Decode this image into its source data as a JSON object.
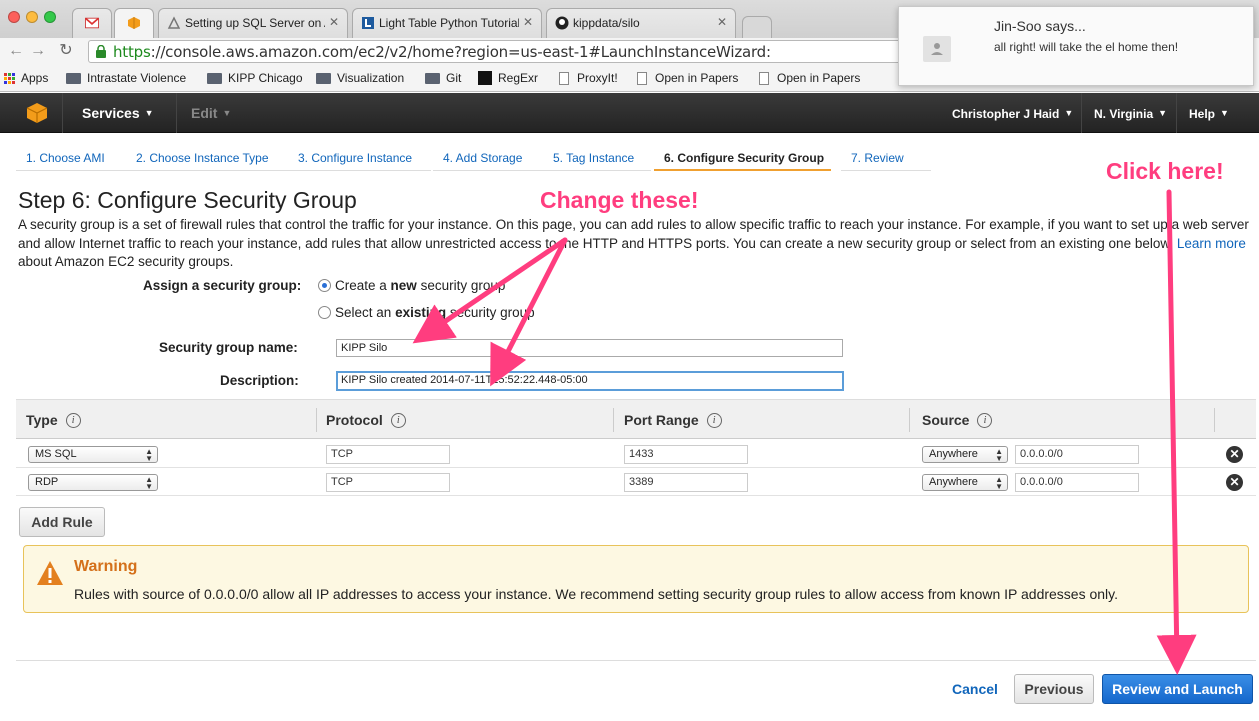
{
  "browser": {
    "tabs": [
      {
        "title": "",
        "icon": "gmail-icon"
      },
      {
        "title": "",
        "icon": "aws-icon"
      },
      {
        "title": "Setting up SQL Server on A",
        "icon": "page-icon"
      },
      {
        "title": "Light Table Python Tutorial",
        "icon": "lighttable-icon"
      },
      {
        "title": "kippdata/silo",
        "icon": "github-icon"
      }
    ],
    "url_scheme": "https",
    "url_rest": "://console.aws.amazon.com/ec2/v2/home?region=us-east-1#LaunchInstanceWizard:",
    "bookmarks": [
      "Apps",
      "Intrastate Violence",
      "KIPP Chicago",
      "Visualization",
      "Git",
      "RegExr",
      "ProxyIt!",
      "Open in Papers",
      "Open in Papers"
    ]
  },
  "notification": {
    "title": "Jin-Soo says...",
    "message": "all right! will take the el home then!"
  },
  "awsnav": {
    "services": "Services",
    "edit": "Edit",
    "user": "Christopher J Haid",
    "region": "N. Virginia",
    "help": "Help"
  },
  "wizard": {
    "steps": [
      "1. Choose AMI",
      "2. Choose Instance Type",
      "3. Configure Instance",
      "4. Add Storage",
      "5. Tag Instance",
      "6. Configure Security Group",
      "7. Review"
    ],
    "active_index": 5
  },
  "page": {
    "title": "Step 6: Configure Security Group",
    "intro": "A security group is a set of firewall rules that control the traffic for your instance. On this page, you can add rules to allow specific traffic to reach your instance. For example, if you want to set up a web server and allow Internet traffic to reach your instance, add rules that allow unrestricted access to the HTTP and HTTPS ports. You can create a new security group or select from an existing one below.",
    "learn_more": "Learn more",
    "intro_tail": "about Amazon EC2 security groups."
  },
  "form": {
    "assign_label": "Assign a security group:",
    "option_new_pre": "Create a",
    "option_new_bold": "new",
    "option_new_post": "security group",
    "option_existing_pre": "Select an",
    "option_existing_bold": "existing",
    "option_existing_post": "security group",
    "name_label": "Security group name:",
    "name_value": "KIPP Silo",
    "desc_label": "Description:",
    "desc_value": "KIPP Silo created 2014-07-11T15:52:22.448-05:00"
  },
  "rules": {
    "headers": [
      "Type",
      "Protocol",
      "Port Range",
      "Source"
    ],
    "rows": [
      {
        "type": "MS SQL",
        "protocol": "TCP",
        "port": "1433",
        "source": "Anywhere",
        "cidr": "0.0.0.0/0"
      },
      {
        "type": "RDP",
        "protocol": "TCP",
        "port": "3389",
        "source": "Anywhere",
        "cidr": "0.0.0.0/0"
      }
    ],
    "add_rule": "Add Rule"
  },
  "warning": {
    "title": "Warning",
    "text": "Rules with source of 0.0.0.0/0 allow all IP addresses to access your instance. We recommend setting security group rules to allow access from known IP addresses only."
  },
  "footer": {
    "cancel": "Cancel",
    "previous": "Previous",
    "review_launch": "Review and Launch"
  },
  "annotations": {
    "change": "Change these!",
    "click": "Click here!",
    "color": "#ff3d7f"
  }
}
